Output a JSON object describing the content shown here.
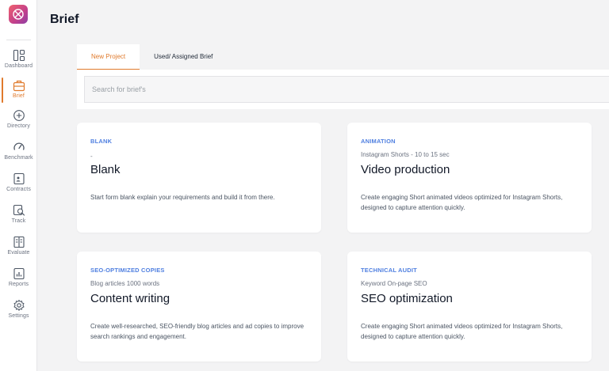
{
  "page": {
    "title": "Brief"
  },
  "sidebar": {
    "items": [
      {
        "label": "Dashboard",
        "icon": "dashboard-icon",
        "active": false
      },
      {
        "label": "Brief",
        "icon": "briefcase-icon",
        "active": true
      },
      {
        "label": "Directory",
        "icon": "plus-circle-icon",
        "active": false
      },
      {
        "label": "Benchmark",
        "icon": "gauge-icon",
        "active": false
      },
      {
        "label": "Contracts",
        "icon": "contract-icon",
        "active": false
      },
      {
        "label": "Track",
        "icon": "track-icon",
        "active": false
      },
      {
        "label": "Evaluate",
        "icon": "book-icon",
        "active": false
      },
      {
        "label": "Reports",
        "icon": "report-icon",
        "active": false
      },
      {
        "label": "Settings",
        "icon": "gear-icon",
        "active": false
      }
    ]
  },
  "tabs": [
    {
      "label": "New Project",
      "active": true
    },
    {
      "label": "Used/ Assigned Brief",
      "active": false
    }
  ],
  "search": {
    "placeholder": "Search for brief's",
    "value": ""
  },
  "cards": [
    {
      "category": "BLANK",
      "subtitle": "-",
      "title": "Blank",
      "description": "Start form blank explain your requirements and build it from there."
    },
    {
      "category": "ANIMATION",
      "subtitle": "Instagram Shorts  -  10 to 15 sec",
      "title": "Video production",
      "description": "Create engaging Short animated videos optimized for Instagram Shorts, designed to capture attention quickly."
    },
    {
      "category": "SEO-OPTIMIZED COPIES",
      "subtitle": "Blog articles 1000 words",
      "title": "Content writing",
      "description": "Create well-researched, SEO-friendly blog articles and ad copies to improve search rankings and engagement."
    },
    {
      "category": "TECHNICAL AUDIT",
      "subtitle": "Keyword  On-page SEO",
      "title": "SEO optimization",
      "description": "Create engaging Short animated videos optimized for Instagram Shorts, designed to capture attention quickly."
    }
  ],
  "colors": {
    "accent": "#e07a2c",
    "category_blue": "#4f7fe0",
    "background": "#f3f3f4",
    "logo_gradient": [
      "#f0616d",
      "#8e3fa6"
    ]
  }
}
